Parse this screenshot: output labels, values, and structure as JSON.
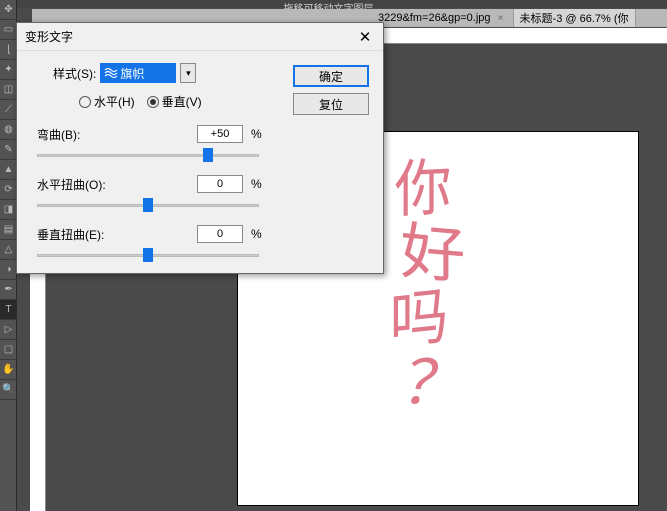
{
  "top_hint": "拖移可移动文字图层。",
  "tabs": [
    {
      "label": "3229&fm=26&gp=0.jpg"
    },
    {
      "label": "未标题-3 @ 66.7% (你"
    }
  ],
  "dialog": {
    "title": "变形文字",
    "style_label": "样式(S):",
    "style_value": "旗帜",
    "orientation": {
      "horizontal": "水平(H)",
      "vertical": "垂直(V)"
    },
    "params": {
      "bend": {
        "label": "弯曲(B):",
        "value": "+50",
        "pct": "%"
      },
      "hdist": {
        "label": "水平扭曲(O):",
        "value": "0",
        "pct": "%"
      },
      "vdist": {
        "label": "垂直扭曲(E):",
        "value": "0",
        "pct": "%"
      }
    },
    "buttons": {
      "ok": "确定",
      "reset": "复位"
    }
  },
  "canvas": {
    "text": {
      "c1": "你",
      "c2": "好",
      "c3": "吗",
      "c4": "？"
    }
  }
}
